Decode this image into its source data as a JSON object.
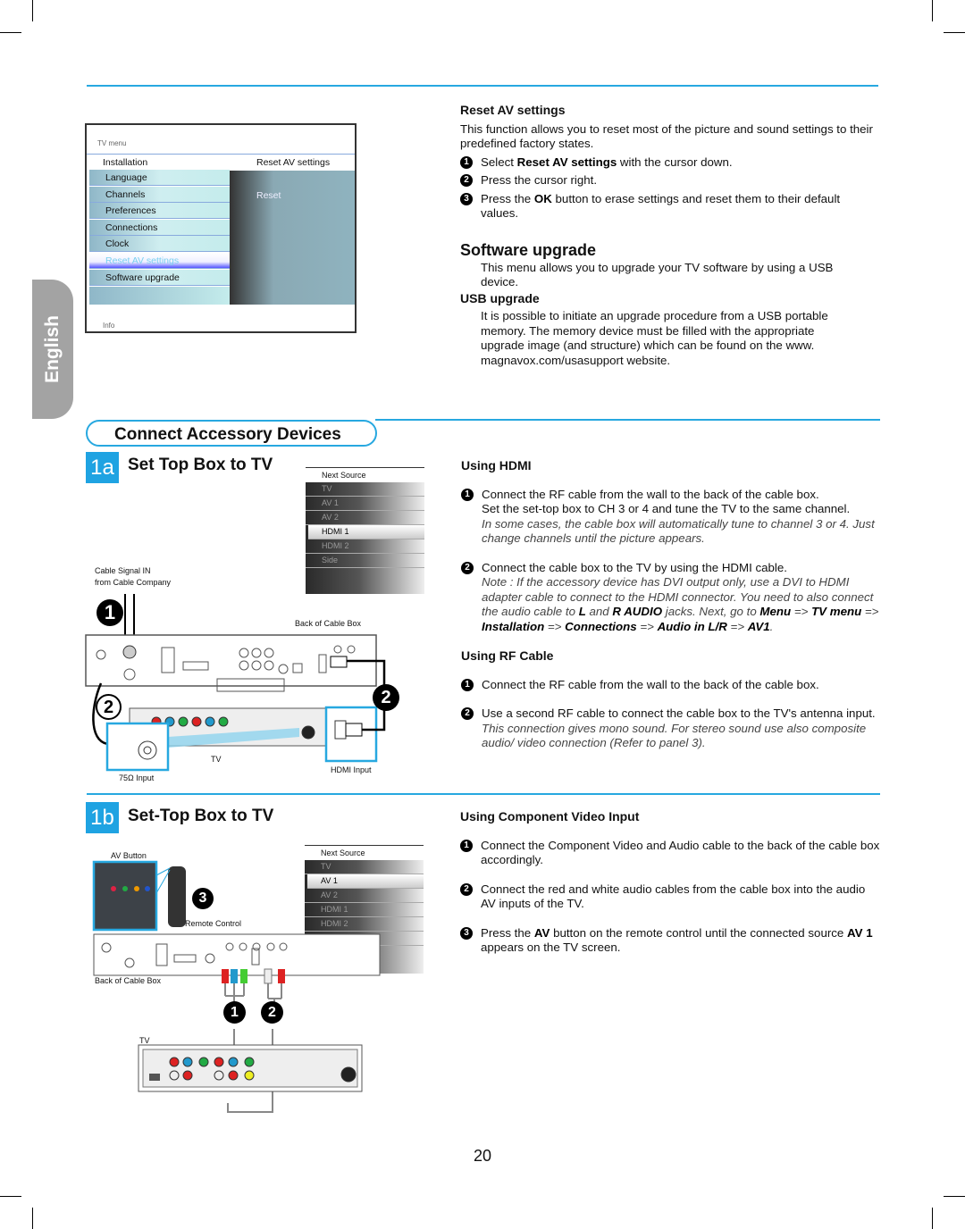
{
  "sidebar_tab": "English",
  "tv_menu": {
    "title": "TV menu",
    "column_left": "Installation",
    "column_right": "Reset AV settings",
    "items": [
      "Language",
      "Channels",
      "Preferences",
      "Connections",
      "Clock",
      "Reset AV settings",
      "Software upgrade"
    ],
    "selected_item": "Reset AV settings",
    "right_item": "Reset",
    "footer": "Info"
  },
  "reset_av": {
    "heading": "Reset AV settings",
    "intro": "This function allows you to reset most of the picture and sound settings to their predefined factory states.",
    "steps": [
      [
        {
          "t": "Select "
        },
        {
          "t": "Reset AV settings",
          "b": 1
        },
        {
          "t": " with the cursor down."
        }
      ],
      [
        {
          "t": "Press the cursor right."
        }
      ],
      [
        {
          "t": "Press the "
        },
        {
          "t": "OK",
          "b": 1
        },
        {
          "t": " button to erase settings and reset them to their default values."
        }
      ]
    ]
  },
  "software_upgrade": {
    "heading": "Software upgrade",
    "intro": "This menu allows you to upgrade your TV software by using a USB device.",
    "usb_heading": "USB upgrade",
    "usb_text": "It is possible to initiate an upgrade procedure from a USB portable memory. The memory device must be filled with the appropriate upgrade image (and structure) which can be found on the www. magnavox.com/usasupport website."
  },
  "section_title": "Connect Accessory Devices",
  "panel_1a": {
    "badge": "1a",
    "title": "Set Top Box to TV",
    "next_source": {
      "header": "Next Source",
      "items": [
        "TV",
        "AV 1",
        "AV 2",
        "HDMI 1",
        "HDMI 2",
        "Side"
      ],
      "selected": "HDMI 1"
    },
    "labels": {
      "cable_signal": "Cable Signal IN",
      "from_company": "from Cable Company",
      "back_of_box": "Back of Cable Box",
      "tv": "TV",
      "input_75": "75Ω Input",
      "hdmi_input": "HDMI Input"
    },
    "callouts": [
      "1",
      "2",
      "2"
    ]
  },
  "using_hdmi": {
    "heading": "Using HDMI",
    "steps": [
      {
        "text": [
          {
            "t": "Connect the RF cable from the wall to the back of the cable box."
          }
        ],
        "sub": [
          {
            "t": "Set the set-top box to CH 3 or 4 and tune the TV to the same channel."
          }
        ],
        "note": [
          {
            "t": "In some cases, the cable box will automatically tune to channel 3 or 4. Just change channels until the picture appears."
          }
        ]
      },
      {
        "text": [
          {
            "t": "Connect the cable box to the TV by using the HDMI cable."
          }
        ],
        "note": [
          {
            "t": "Note : If the accessory device has DVI output only, use a DVI to HDMI adapter cable to connect to the HDMI connector. You need to also connect the audio cable to "
          },
          {
            "t": "L",
            "b": 1
          },
          {
            "t": " and "
          },
          {
            "t": "R AUDIO",
            "b": 1
          },
          {
            "t": " jacks. Next, go to "
          },
          {
            "t": "Menu",
            "b": 1
          },
          {
            "t": " => "
          },
          {
            "t": "TV menu",
            "b": 1
          },
          {
            "t": " => "
          },
          {
            "t": "Installation",
            "b": 1
          },
          {
            "t": " => "
          },
          {
            "t": "Connections",
            "b": 1
          },
          {
            "t": " => "
          },
          {
            "t": "Audio in L/R",
            "b": 1
          },
          {
            "t": " => "
          },
          {
            "t": "AV1",
            "b": 1
          },
          {
            "t": "."
          }
        ]
      }
    ]
  },
  "using_rf": {
    "heading": "Using RF Cable",
    "steps": [
      {
        "text": [
          {
            "t": "Connect the RF cable from the wall to the back of the cable box."
          }
        ]
      },
      {
        "text": [
          {
            "t": "Use a second RF cable to connect the cable box to the TV's antenna input."
          }
        ],
        "note": [
          {
            "t": "This connection gives mono sound. For stereo sound use also composite audio/ video connection (Refer to panel 3)."
          }
        ]
      }
    ]
  },
  "panel_1b": {
    "badge": "1b",
    "title": "Set-Top Box to TV",
    "next_source": {
      "header": "Next Source",
      "items": [
        "TV",
        "AV 1",
        "AV 2",
        "HDMI 1",
        "HDMI 2",
        "Side"
      ],
      "selected": "AV 1"
    },
    "labels": {
      "av_button": "AV Button",
      "remote": "Remote Control",
      "back_of_box": "Back of Cable Box",
      "tv": "TV"
    },
    "callouts": [
      "3",
      "1",
      "2"
    ]
  },
  "using_component": {
    "heading": "Using Component Video Input",
    "steps": [
      {
        "text": [
          {
            "t": "Connect the Component Video and Audio cable to the back of the cable box accordingly."
          }
        ]
      },
      {
        "text": [
          {
            "t": "Connect the red and white audio cables from the cable box into the audio AV inputs of the TV."
          }
        ]
      },
      {
        "text": [
          {
            "t": "Press the "
          },
          {
            "t": "AV",
            "b": 1
          },
          {
            "t": " button on the remote control until the connected source "
          },
          {
            "t": "AV 1",
            "b": 1
          },
          {
            "t": " appears on the TV screen."
          }
        ]
      }
    ]
  },
  "page_number": "20",
  "colors": {
    "accent": "#27a8e0",
    "badge": "#1fa3e2",
    "tab": "#a3a3a3"
  }
}
